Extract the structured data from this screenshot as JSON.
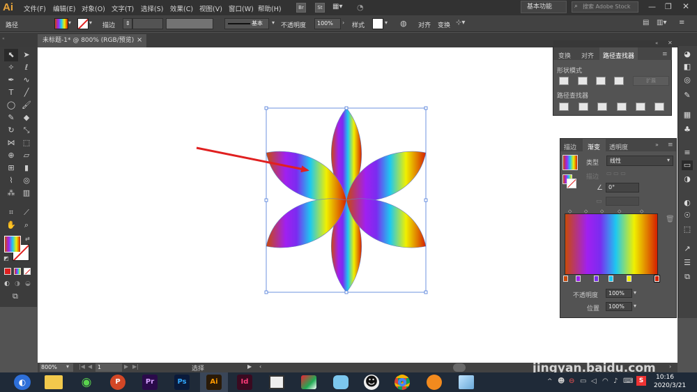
{
  "app": {
    "logo": "Ai",
    "name": "Adobe Illustrator"
  },
  "menu": [
    "文件(F)",
    "编辑(E)",
    "对象(O)",
    "文字(T)",
    "选择(S)",
    "效果(C)",
    "视图(V)",
    "窗口(W)",
    "帮助(H)"
  ],
  "bridge_buttons": [
    "Br",
    "St"
  ],
  "workspace": "基本功能",
  "stock_search": {
    "placeholder": "搜索 Adobe Stock"
  },
  "control": {
    "selection_type": "路径",
    "stroke_label": "描边",
    "brush": "基本",
    "opacity_label": "不透明度",
    "opacity_value": "100%",
    "style_label": "样式",
    "align_label": "对齐",
    "transform_label": "变换"
  },
  "document_tab": {
    "title": "未标题-1* @ 800% (RGB/预览)",
    "close": "×"
  },
  "pathfinder_panel": {
    "tabs": [
      "变换",
      "对齐",
      "路径查找器"
    ],
    "active_tab": "路径查找器",
    "shape_modes_label": "形状模式",
    "expand_button": "扩展",
    "pathfinders_label": "路径查找器"
  },
  "gradient_panel": {
    "tabs": [
      "描边",
      "渐变",
      "透明度"
    ],
    "active_tab": "渐变",
    "type_label": "类型",
    "type_value": "线性",
    "stroke_label": "描边",
    "angle_value": "0°",
    "opacity_label": "不透明度",
    "opacity_value": "100%",
    "location_label": "位置",
    "location_value": "100%",
    "gradient_stops": [
      "#c84a0a",
      "#a020f0",
      "#7a2cf0",
      "#1ec8f0",
      "#f0f000",
      "#d42000"
    ]
  },
  "status": {
    "zoom": "800%",
    "artboard": "1",
    "tool": "选择"
  },
  "taskbar": {
    "apps": [
      "PowerPoint",
      "Premiere",
      "Photoshop",
      "Illustrator",
      "InDesign",
      "Chrome",
      "QQ"
    ],
    "app_labels": {
      "pp": "P",
      "pr": "Pr",
      "ps": "Ps",
      "ai": "Ai",
      "id": "Id"
    },
    "tray": "S",
    "time": "10:16",
    "date": "2020/3/21"
  },
  "watermark": {
    "brand": "Bai",
    "brand_cn": "经验",
    "url": "jingyan.baidu.com"
  },
  "colors": {
    "accent": "#e8a43a",
    "selection": "#4a78d8",
    "annotation_arrow": "#e02020"
  }
}
